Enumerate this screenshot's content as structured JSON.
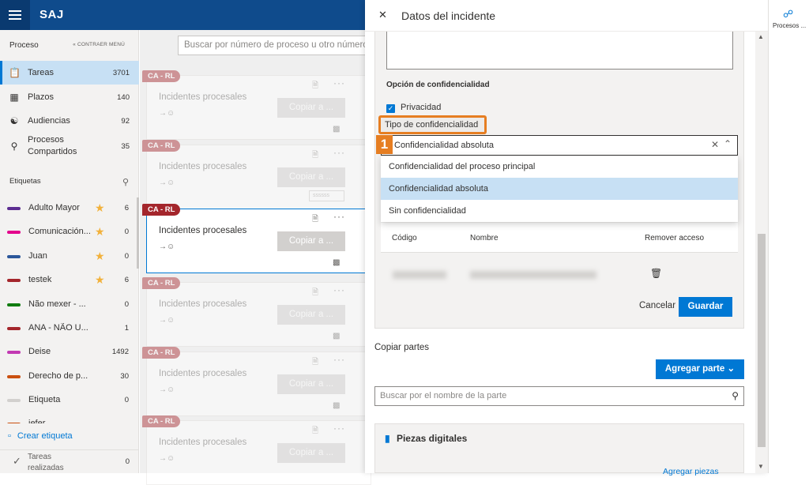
{
  "topbar": {
    "brand": "SAJ"
  },
  "sidebar": {
    "section_title": "Proceso",
    "collapse_label": "« CONTRAER MENÚ",
    "nav": [
      {
        "label": "Tareas",
        "count": "3701",
        "icon": "clipboard-icon"
      },
      {
        "label": "Plazos",
        "count": "140",
        "icon": "calendar-icon"
      },
      {
        "label": "Audiencias",
        "count": "92",
        "icon": "people-icon"
      },
      {
        "label": "Procesos Compartidos",
        "count": "35",
        "icon": "share-people-icon"
      }
    ],
    "tags_title": "Etiquetas",
    "tags": [
      {
        "label": "Adulto Mayor",
        "count": "6",
        "color": "#5c2d91",
        "star": true
      },
      {
        "label": "Comunicación...",
        "count": "0",
        "color": "#e3008c",
        "star": true
      },
      {
        "label": "Juan",
        "count": "0",
        "color": "#2b579a",
        "star": true
      },
      {
        "label": "testek",
        "count": "6",
        "color": "#a4262c",
        "star": true
      },
      {
        "label": "Não mexer - ...",
        "count": "0",
        "color": "#107c10",
        "star": false
      },
      {
        "label": "ANA - NÃO U...",
        "count": "1",
        "color": "#a4262c",
        "star": false
      },
      {
        "label": "Deise",
        "count": "1492",
        "color": "#c239b3",
        "star": false
      },
      {
        "label": "Derecho de p...",
        "count": "30",
        "color": "#ca5010",
        "star": false
      },
      {
        "label": "Etiqueta",
        "count": "0",
        "color": "#d2d0ce",
        "star": false
      },
      {
        "label": "jefer",
        "count": "",
        "color": "#ca5010",
        "star": false
      }
    ],
    "create_tag": "Crear etiqueta",
    "done_label": "Tareas realizadas",
    "done_count": "0"
  },
  "main": {
    "search_placeholder": "Buscar por número de proceso u otro número",
    "cards": [
      {
        "badge": "CA - RL",
        "title": "Incidentes procesales",
        "copy": "Copiar a ..."
      },
      {
        "badge": "CA - RL",
        "title": "Incidentes procesales",
        "copy": "Copiar a ...",
        "tagbox": "ssssss"
      },
      {
        "badge": "CA - RL",
        "title": "Incidentes procesales",
        "copy": "Copiar a ..."
      },
      {
        "badge": "CA - RL",
        "title": "Incidentes procesales",
        "copy": "Copiar a ..."
      },
      {
        "badge": "CA - RL",
        "title": "Incidentes procesales",
        "copy": "Copiar a ..."
      },
      {
        "badge": "CA - RL",
        "title": "Incidentes procesales",
        "copy": "Copiar a ..."
      }
    ]
  },
  "panel": {
    "title": "Datos del incidente",
    "conf_option_label": "Opción de confidencialidad",
    "privacy_label": "Privacidad",
    "tipo_label": "Tipo de confidencialidad",
    "step_number": "1",
    "dropdown_value": "Confidencialidad absoluta",
    "options": [
      "Confidencialidad del proceso principal",
      "Confidencialidad absoluta",
      "Sin confidencialidad"
    ],
    "table_headers": {
      "code": "Código",
      "name": "Nombre",
      "remove": "Remover acceso"
    },
    "cancel": "Cancelar",
    "save": "Guardar",
    "copy_parts": "Copiar partes",
    "add_party": "Agregar parte",
    "party_search_placeholder": "Buscar por el nombre de la parte",
    "digital_pieces": "Piezas digitales",
    "add_pieces": "Agregar piezas"
  },
  "rightrail": {
    "label": "Procesos ..."
  }
}
